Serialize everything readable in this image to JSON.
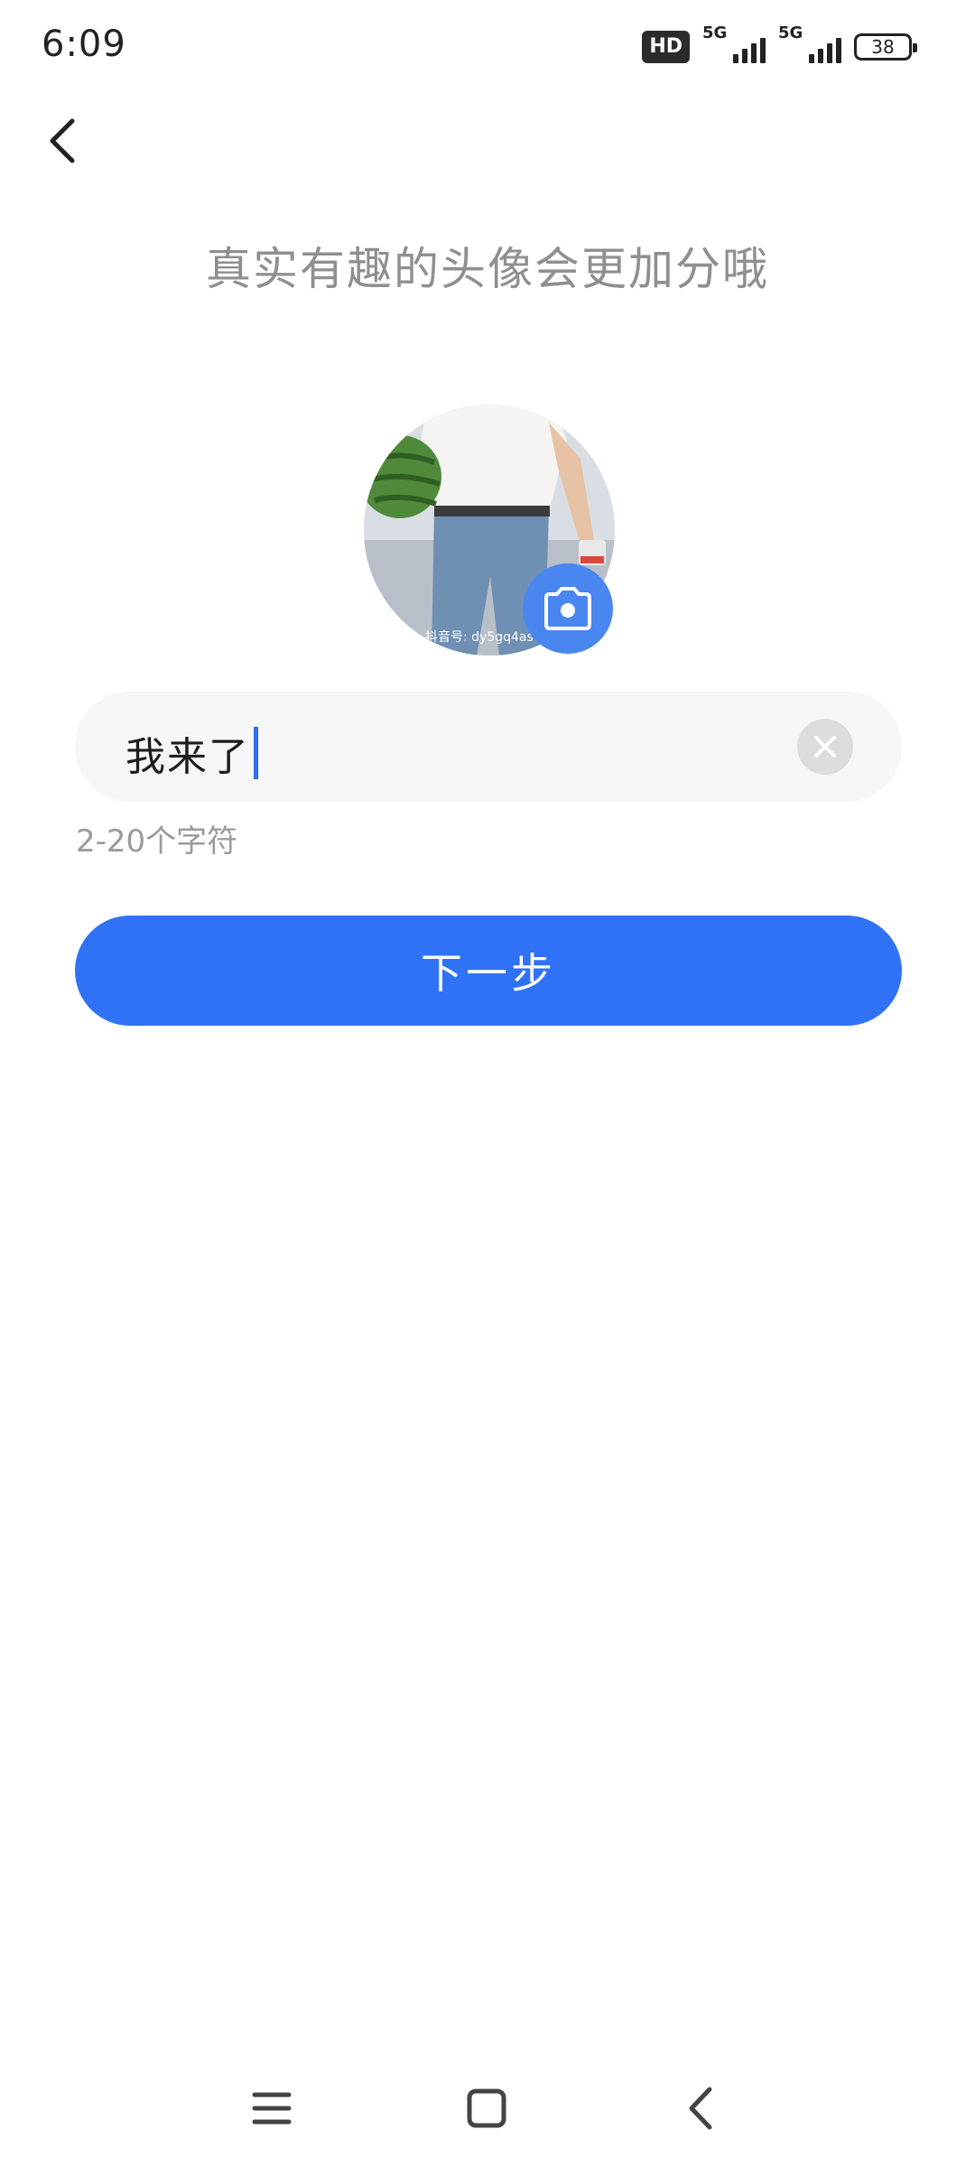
{
  "status_bar": {
    "time": "6:09",
    "hd_label": "HD",
    "network_1": "5G",
    "network_2": "5G",
    "battery": "38"
  },
  "header": {
    "back_icon": "chevron-left-icon"
  },
  "heading": "真实有趣的头像会更加分哦",
  "avatar": {
    "camera_icon": "camera-icon",
    "watermark": "抖音号: dy5gq4as"
  },
  "nickname": {
    "value": "我来了",
    "clear_icon": "close-icon"
  },
  "hint": "2-20个字符",
  "next_button": "下一步",
  "nav_bar": {
    "menu_icon": "menu-icon",
    "home_icon": "home-icon",
    "back_icon": "back-icon"
  },
  "colors": {
    "accent": "#2f72f6",
    "camera": "#4a86f0",
    "caret": "#2f6cf0"
  }
}
